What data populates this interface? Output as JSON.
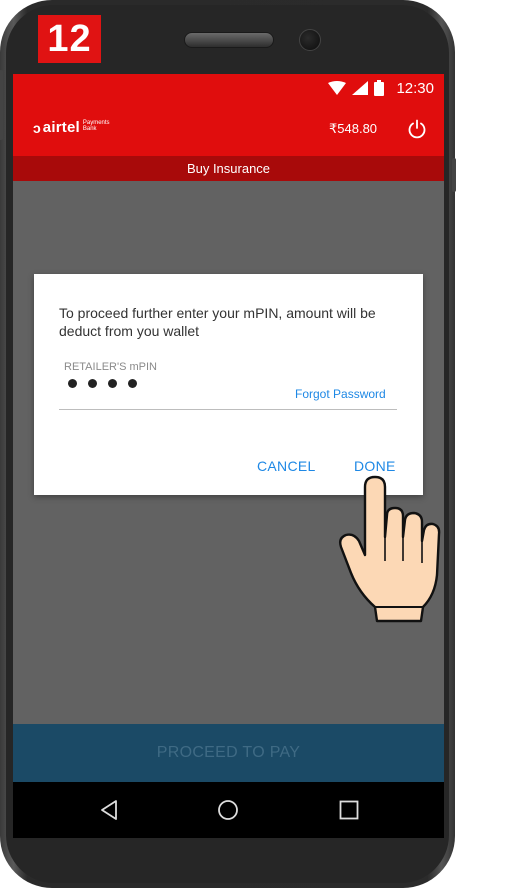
{
  "step": {
    "number": "12"
  },
  "status_bar": {
    "time": "12:30",
    "icons": [
      "wifi-icon",
      "signal-icon",
      "battery-icon"
    ]
  },
  "app_bar": {
    "logo": {
      "word": "airtel",
      "sub_line1": "Payments",
      "sub_line2": "Bank"
    },
    "balance": "₹548.80",
    "power_icon": "power-icon"
  },
  "subheader": {
    "title": "Buy Insurance"
  },
  "dialog": {
    "message": "To proceed further enter your mPIN, amount will be deduct from you wallet",
    "pin_label": "RETAILER'S mPIN",
    "pin_value": "••••",
    "forgot_password": "Forgot Password",
    "cancel": "CANCEL",
    "done": "DONE"
  },
  "footer": {
    "proceed": "PROCEED TO PAY"
  },
  "nav": {
    "icons": [
      "back-icon",
      "home-icon",
      "recents-icon"
    ]
  },
  "colors": {
    "brand_red": "#e00d0d",
    "subheader_red": "#a80a0a",
    "link_blue": "#1e88e5",
    "proceed_bg": "#1b4a66",
    "overlay_gray": "#626262"
  }
}
